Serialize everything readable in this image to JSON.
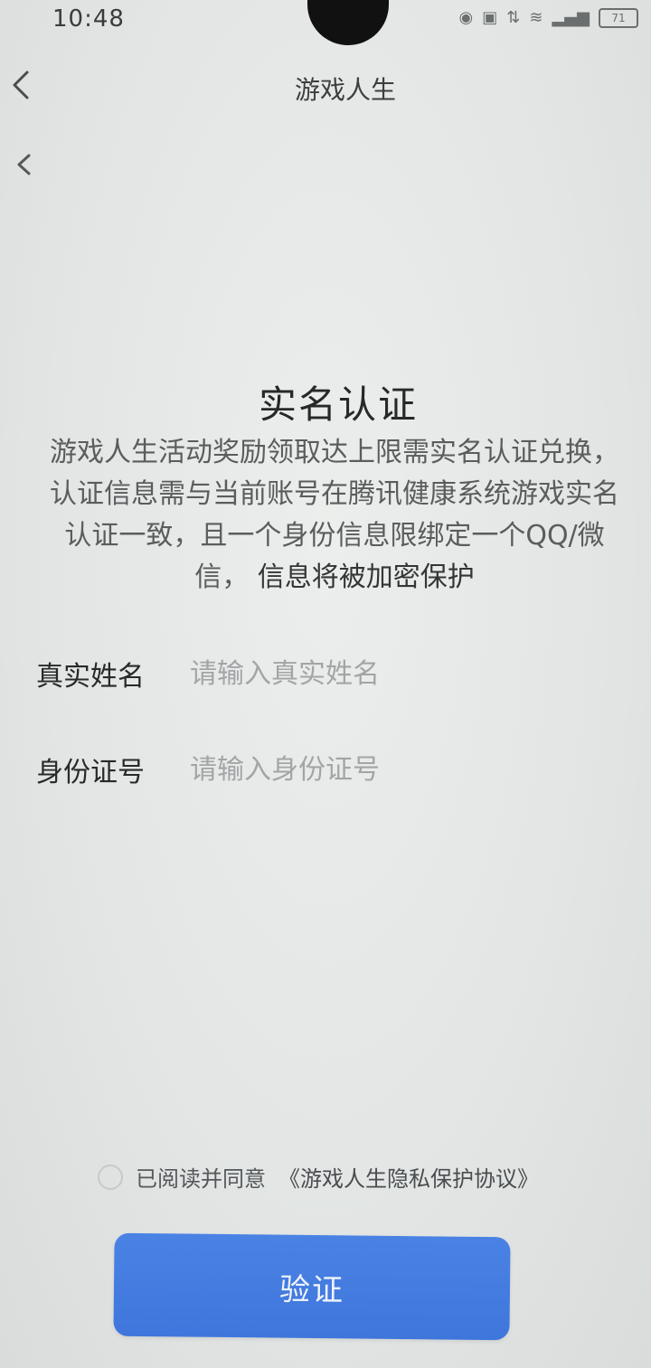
{
  "status_bar": {
    "time": "10:48",
    "battery": "71"
  },
  "nav": {
    "title": "游戏人生"
  },
  "main": {
    "title": "实名认证",
    "description_lines": [
      "游戏人生活动奖励领取达上限需实名认证兑换，",
      "认证信息需与当前账号在腾讯健康系统游戏实名",
      "认证一致，且一个身份信息限绑定一个QQ/微",
      "信，"
    ],
    "description_emphasis": "信息将被加密保护"
  },
  "form": {
    "name_label": "真实姓名",
    "name_placeholder": "请输入真实姓名",
    "id_label": "身份证号",
    "id_placeholder": "请输入身份证号"
  },
  "agreement": {
    "text": "已阅读并同意",
    "link": "《游戏人生隐私保护协议》"
  },
  "actions": {
    "verify_label": "验证"
  },
  "colors": {
    "primary_button": "#4a82e4",
    "background": "#e4e7e6"
  }
}
